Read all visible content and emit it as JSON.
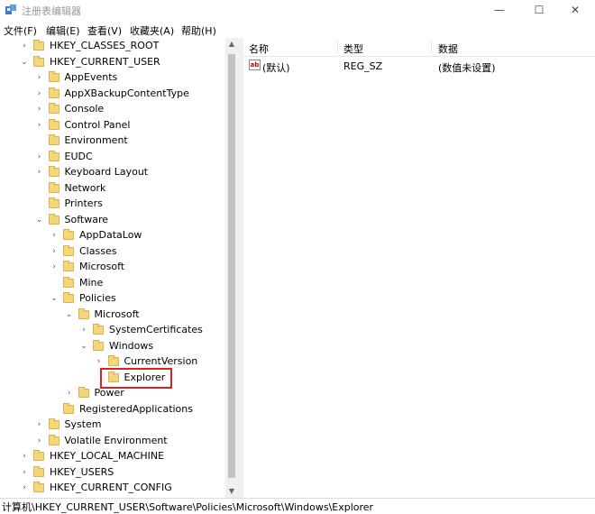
{
  "window": {
    "title": "注册表编辑器",
    "minimize": "—",
    "maximize": "☐",
    "close": "✕"
  },
  "menu": [
    "文件(F)",
    "编辑(E)",
    "查看(V)",
    "收藏夹(A)",
    "帮助(H)"
  ],
  "tree": [
    {
      "label": "HKEY_CLASSES_ROOT",
      "depth": 0,
      "expander": "collapsed"
    },
    {
      "label": "HKEY_CURRENT_USER",
      "depth": 0,
      "expander": "expanded"
    },
    {
      "label": "AppEvents",
      "depth": 1,
      "expander": "collapsed"
    },
    {
      "label": "AppXBackupContentType",
      "depth": 1,
      "expander": "collapsed"
    },
    {
      "label": "Console",
      "depth": 1,
      "expander": "collapsed"
    },
    {
      "label": "Control Panel",
      "depth": 1,
      "expander": "collapsed"
    },
    {
      "label": "Environment",
      "depth": 1,
      "expander": "none"
    },
    {
      "label": "EUDC",
      "depth": 1,
      "expander": "collapsed"
    },
    {
      "label": "Keyboard Layout",
      "depth": 1,
      "expander": "collapsed"
    },
    {
      "label": "Network",
      "depth": 1,
      "expander": "none"
    },
    {
      "label": "Printers",
      "depth": 1,
      "expander": "none"
    },
    {
      "label": "Software",
      "depth": 1,
      "expander": "expanded"
    },
    {
      "label": "AppDataLow",
      "depth": 2,
      "expander": "collapsed"
    },
    {
      "label": "Classes",
      "depth": 2,
      "expander": "collapsed"
    },
    {
      "label": "Microsoft",
      "depth": 2,
      "expander": "collapsed"
    },
    {
      "label": "Mine",
      "depth": 2,
      "expander": "none"
    },
    {
      "label": "Policies",
      "depth": 2,
      "expander": "expanded"
    },
    {
      "label": "Microsoft",
      "depth": 3,
      "expander": "expanded"
    },
    {
      "label": "SystemCertificates",
      "depth": 4,
      "expander": "collapsed"
    },
    {
      "label": "Windows",
      "depth": 4,
      "expander": "expanded"
    },
    {
      "label": "CurrentVersion",
      "depth": 5,
      "expander": "collapsed"
    },
    {
      "label": "Explorer",
      "depth": 5,
      "expander": "none",
      "selected": true
    },
    {
      "label": "Power",
      "depth": 3,
      "expander": "collapsed"
    },
    {
      "label": "RegisteredApplications",
      "depth": 2,
      "expander": "none"
    },
    {
      "label": "System",
      "depth": 1,
      "expander": "collapsed"
    },
    {
      "label": "Volatile Environment",
      "depth": 1,
      "expander": "collapsed"
    },
    {
      "label": "HKEY_LOCAL_MACHINE",
      "depth": 0,
      "expander": "collapsed"
    },
    {
      "label": "HKEY_USERS",
      "depth": 0,
      "expander": "collapsed"
    },
    {
      "label": "HKEY_CURRENT_CONFIG",
      "depth": 0,
      "expander": "collapsed"
    }
  ],
  "list": {
    "columns": [
      "名称",
      "类型",
      "数据"
    ],
    "rows": [
      {
        "icon": "ab",
        "name": "(默认)",
        "type": "REG_SZ",
        "data": "(数值未设置)"
      }
    ]
  },
  "status": {
    "path": "计算机\\HKEY_CURRENT_USER\\Software\\Policies\\Microsoft\\Windows\\Explorer"
  },
  "colors": {
    "highlight": "#e02020",
    "folder": "#f5d67a"
  },
  "icons": {
    "expanded": "⌄",
    "collapsed": "›",
    "scroll_up": "▲",
    "scroll_down": "▼"
  }
}
